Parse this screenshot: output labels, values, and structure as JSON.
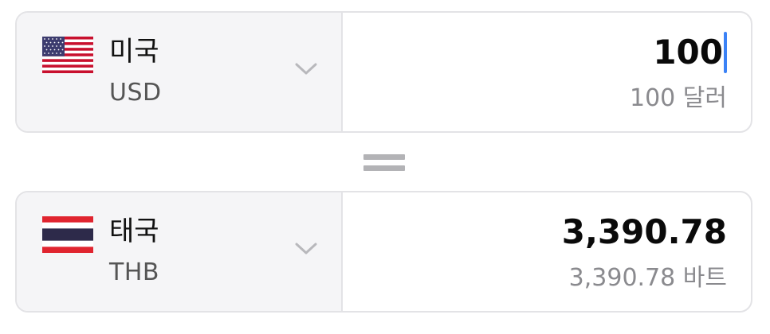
{
  "from": {
    "country": "미국",
    "code": "USD",
    "flag_icon": "us-flag-icon",
    "amount": "100",
    "amount_words": "100 달러"
  },
  "to": {
    "country": "태국",
    "code": "THB",
    "flag_icon": "thailand-flag-icon",
    "amount": "3,390.78",
    "amount_words": "3,390.78 바트"
  },
  "colors": {
    "caret": "#3b82f6",
    "picker_bg": "#f5f5f7",
    "border": "#e3e3e6",
    "secondary_text": "#8a8a8e"
  }
}
